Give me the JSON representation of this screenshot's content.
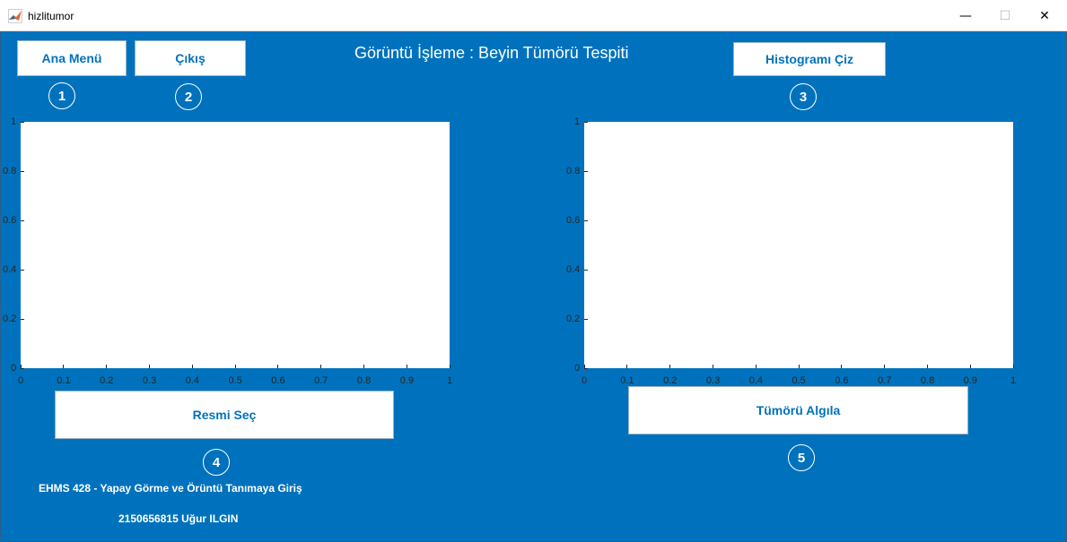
{
  "window": {
    "title": "hizlitumor",
    "minimize_glyph": "—",
    "maximize_glyph": "☐",
    "close_glyph": "✕"
  },
  "colors": {
    "panel_bg": "#0072bd",
    "button_text": "#0072bd",
    "axes_bg": "#ffffff"
  },
  "heading": "Görüntü İşleme : Beyin Tümörü Tespiti",
  "buttons": {
    "ana_menu": "Ana Menü",
    "cikis": "Çıkış",
    "histogram": "Histogramı Çiz",
    "resmi_sec": "Resmi Seç",
    "tumoru_algila": "Tümörü Algıla"
  },
  "markers": [
    "1",
    "2",
    "3",
    "4",
    "5"
  ],
  "axes": {
    "x_ticks": [
      "0",
      "0.1",
      "0.2",
      "0.3",
      "0.4",
      "0.5",
      "0.6",
      "0.7",
      "0.8",
      "0.9",
      "1"
    ],
    "y_ticks": [
      "0",
      "0.2",
      "0.4",
      "0.6",
      "0.8",
      "1"
    ]
  },
  "footer": {
    "course": "EHMS 428 - Yapay Görme ve Örüntü Tanımaya Giriş",
    "student": "2150656815  Uğur ILGIN"
  }
}
